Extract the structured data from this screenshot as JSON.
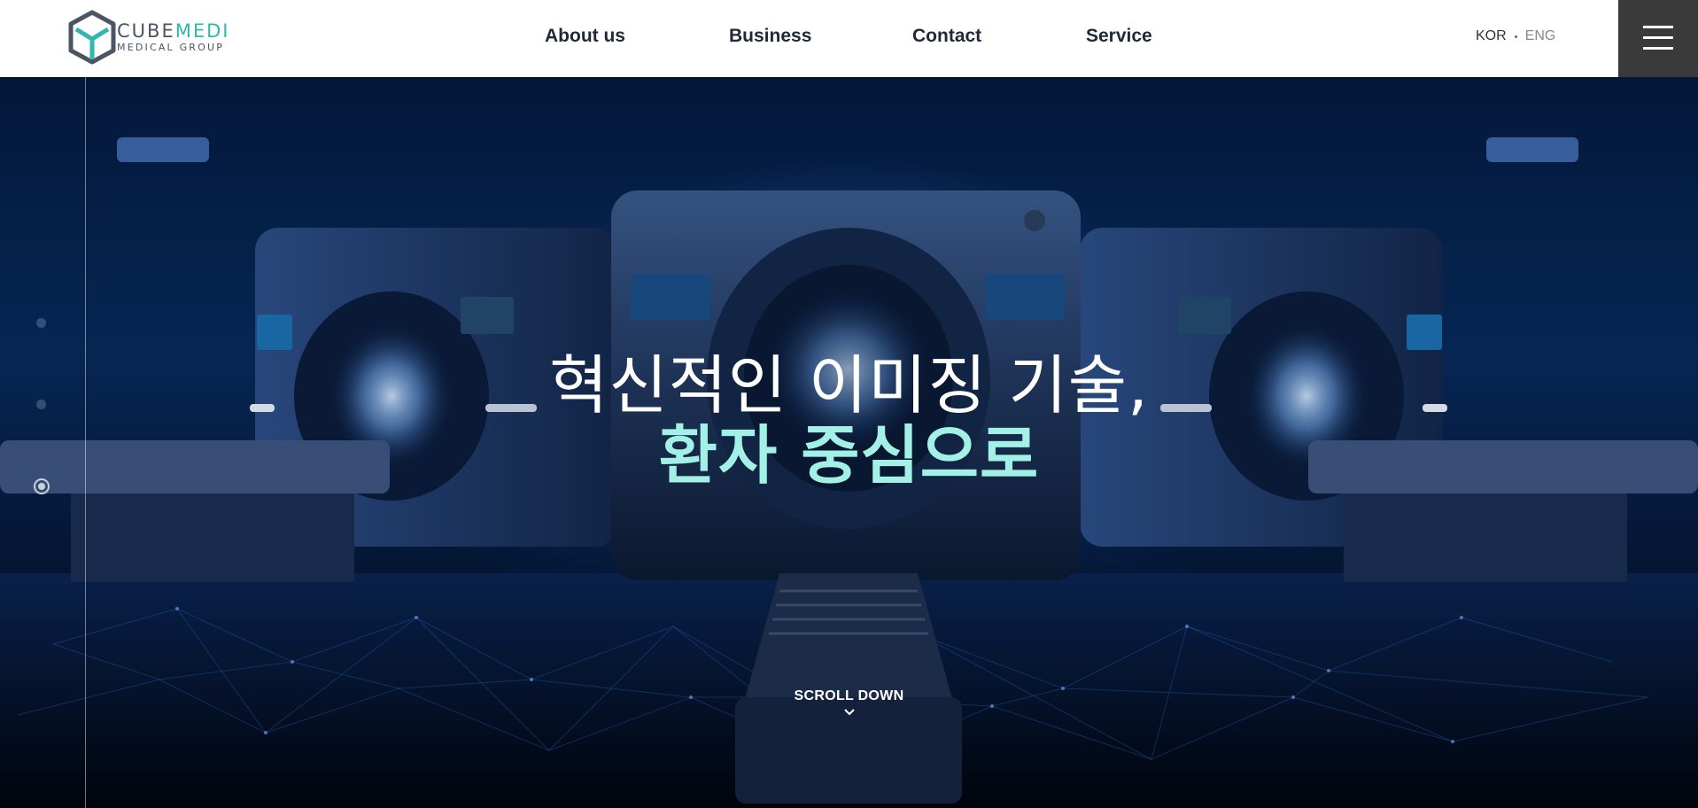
{
  "brand": {
    "name_part1": "CUBE",
    "name_part2": "MEDI",
    "subtitle": "MEDICAL GROUP"
  },
  "nav": {
    "items": [
      "About us",
      "Business",
      "Contact",
      "Service"
    ]
  },
  "lang": {
    "kor": "KOR",
    "eng": "ENG"
  },
  "hero": {
    "line1": "혁신적인 이미징 기술,",
    "line2": "환자 중심으로",
    "scroll_label": "SCROLL DOWN",
    "slides_total": 3,
    "active_slide": 3
  },
  "colors": {
    "accent": "#32b7ad",
    "headline_accent": "#a3f0e6",
    "menu_bg": "#3a3a3a"
  },
  "icons": {
    "menu": "hamburger-icon",
    "scroll": "chevron-down-icon"
  }
}
